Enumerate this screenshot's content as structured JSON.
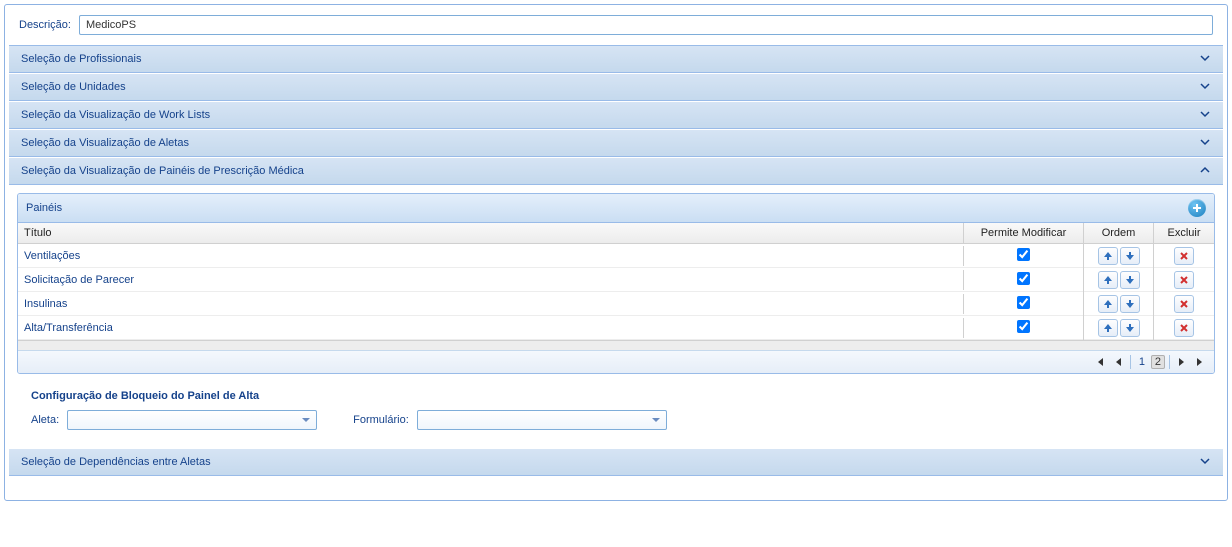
{
  "description": {
    "label": "Descrição:",
    "value": "MedicoPS"
  },
  "accordions": {
    "profissionais": "Seleção de Profissionais",
    "unidades": "Seleção de Unidades",
    "worklists": "Seleção da Visualização de Work Lists",
    "aletas": "Seleção da Visualização de Aletas",
    "paineis": "Seleção da Visualização de Painéis de Prescrição Médica",
    "dependencias": "Seleção de Dependências entre Aletas"
  },
  "panel": {
    "title": "Painéis",
    "columns": {
      "titulo": "Título",
      "permite": "Permite Modificar",
      "ordem": "Ordem",
      "excluir": "Excluir"
    },
    "rows": [
      {
        "titulo": "Ventilações",
        "permite": true
      },
      {
        "titulo": "Solicitação de Parecer",
        "permite": true
      },
      {
        "titulo": "Insulinas",
        "permite": true
      },
      {
        "titulo": "Alta/Transferência",
        "permite": true
      }
    ],
    "pager": {
      "page1": "1",
      "page2": "2"
    }
  },
  "config": {
    "title": "Configuração de Bloqueio do Painel de Alta",
    "aleta_label": "Aleta:",
    "formulario_label": "Formulário:"
  }
}
